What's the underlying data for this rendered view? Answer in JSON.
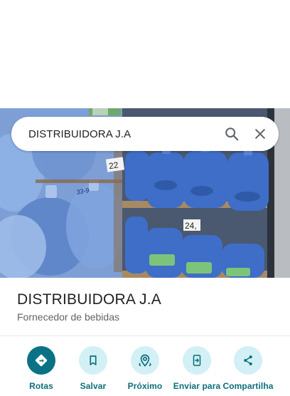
{
  "search": {
    "query": "DISTRIBUIDORA J.A",
    "icons": {
      "search": "search-icon",
      "clear": "close-icon"
    }
  },
  "photo": {
    "description_icon": "place-photo",
    "price_tags": [
      "22",
      "24,",
      "33-9"
    ]
  },
  "place": {
    "name": "DISTRIBUIDORA J.A",
    "category": "Fornecedor de bebidas"
  },
  "actions": [
    {
      "label": "Rotas",
      "icon": "directions-icon",
      "color": "#0b7285"
    },
    {
      "label": "Salvar",
      "icon": "bookmark-icon",
      "color": "#d2f0f5"
    },
    {
      "label": "Próximo",
      "icon": "nearby-icon",
      "color": "#d2f0f5"
    },
    {
      "label": "Enviar para",
      "icon": "send-to-phone-icon",
      "color": "#d2f0f5"
    },
    {
      "label": "Compartilha",
      "icon": "share-icon",
      "color": "#d2f0f5"
    }
  ],
  "colors": {
    "accent": "#0b7285",
    "accent_light": "#d2f0f5",
    "label": "#0b6e7a"
  }
}
